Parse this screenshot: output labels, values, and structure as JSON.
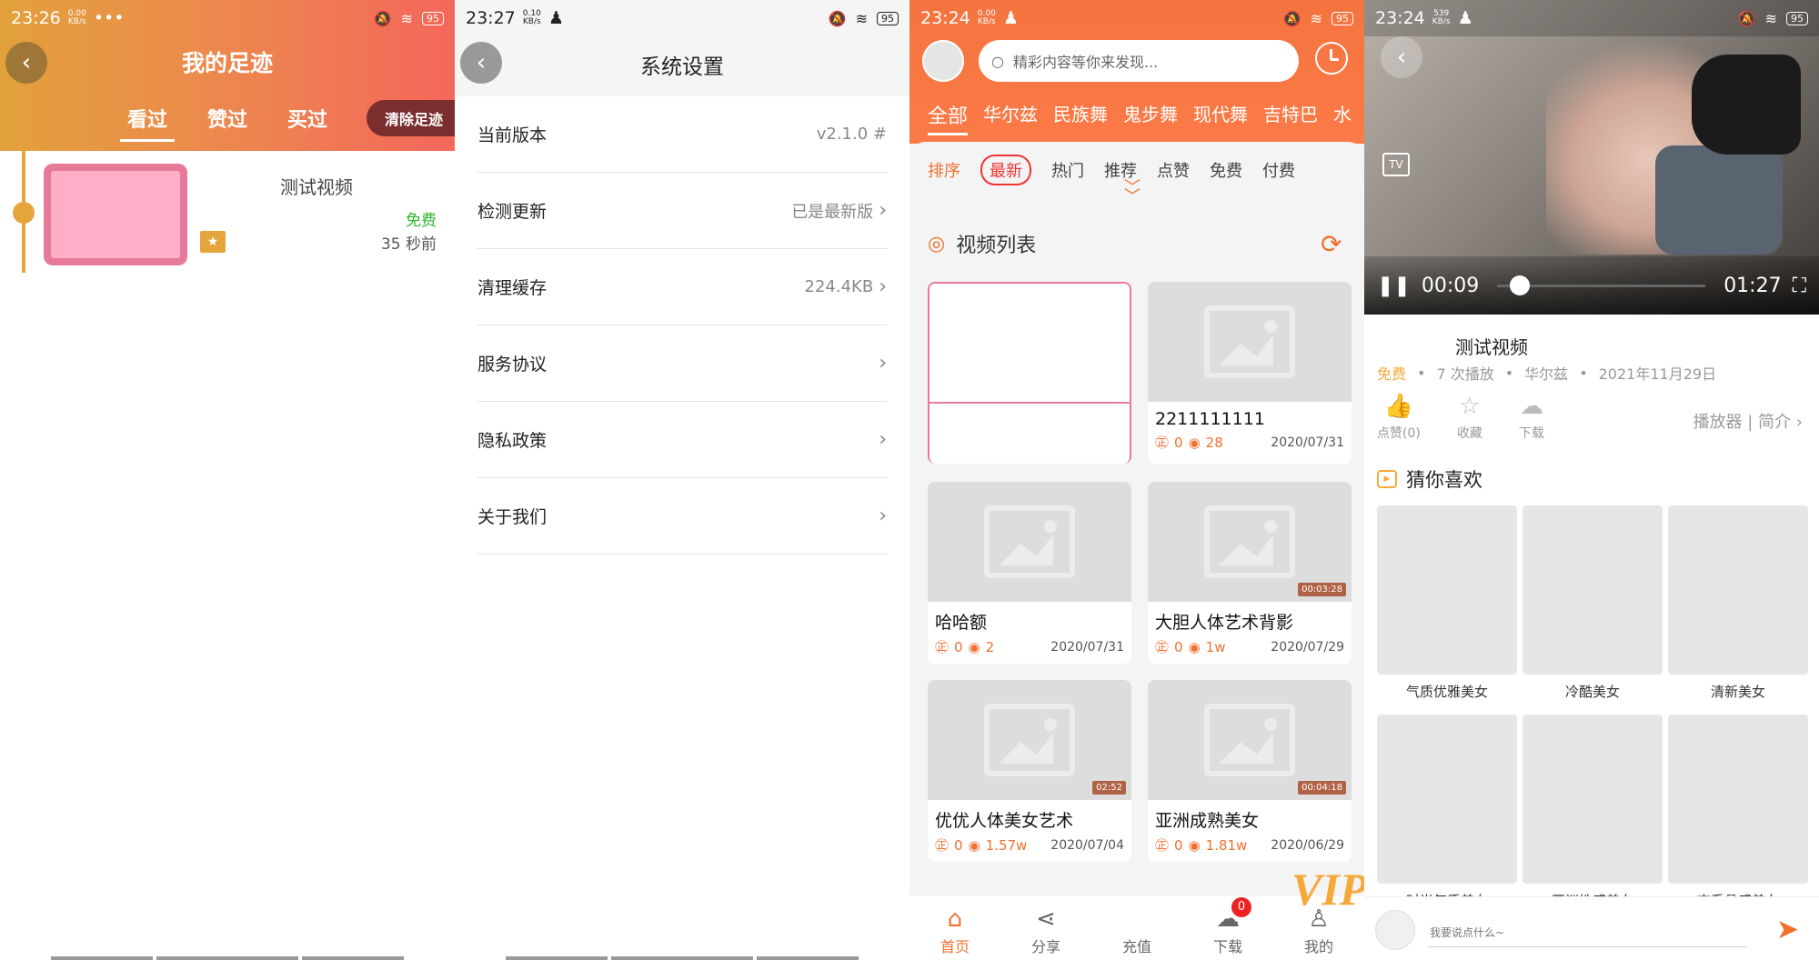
{
  "panel1": {
    "status": {
      "time": "23:26",
      "speed_top": "0.00",
      "speed_bottom": "KB/s",
      "extra": "•••",
      "battery": "95"
    },
    "title": "我的足迹",
    "tabs": [
      "看过",
      "赞过",
      "买过"
    ],
    "clear_label": "清除足迹",
    "item": {
      "title": "测试视频",
      "price": "免费",
      "ago": "35 秒前",
      "star": "★"
    }
  },
  "panel2": {
    "status": {
      "time": "23:27",
      "speed_top": "0.10",
      "speed_bottom": "KB/s",
      "battery": "95"
    },
    "title": "系统设置",
    "rows": [
      {
        "label": "当前版本",
        "value": "v2.1.0 #",
        "chev": ""
      },
      {
        "label": "检测更新",
        "value": "已是最新版",
        "chev": "›"
      },
      {
        "label": "清理缓存",
        "value": "224.4KB",
        "chev": "›"
      },
      {
        "label": "服务协议",
        "value": "",
        "chev": "›"
      },
      {
        "label": "隐私政策",
        "value": "",
        "chev": "›"
      },
      {
        "label": "关于我们",
        "value": "",
        "chev": "›"
      }
    ]
  },
  "panel3": {
    "status": {
      "time": "23:24",
      "speed_top": "0.00",
      "speed_bottom": "KB/s",
      "battery": "95"
    },
    "search_placeholder": "精彩内容等你来发现...",
    "categories": [
      "全部",
      "华尔兹",
      "民族舞",
      "鬼步舞",
      "现代舞",
      "吉特巴",
      "水"
    ],
    "sorts": [
      "排序",
      "最新",
      "热门",
      "推荐",
      "点赞",
      "免费",
      "付费"
    ],
    "list_title": "视频列表",
    "cards": [
      {
        "title": "",
        "likes": "",
        "views": "",
        "date": "",
        "dur": ""
      },
      {
        "title": "2211111111",
        "likes": "0",
        "views": "28",
        "date": "2020/07/31",
        "dur": ""
      },
      {
        "title": "哈哈额",
        "likes": "0",
        "views": "2",
        "date": "2020/07/31",
        "dur": ""
      },
      {
        "title": "大胆人体艺术背影",
        "likes": "0",
        "views": "1w",
        "date": "2020/07/29",
        "dur": "00:03:28"
      },
      {
        "title": "优优人体美女艺术",
        "likes": "0",
        "views": "1.57w",
        "date": "2020/07/04",
        "dur": "02:52"
      },
      {
        "title": "亚洲成熟美女",
        "likes": "0",
        "views": "1.81w",
        "date": "2020/06/29",
        "dur": "00:04:18"
      }
    ],
    "nav": [
      {
        "label": "首页",
        "icon": "⌂"
      },
      {
        "label": "分享",
        "icon": "⋖"
      },
      {
        "label": "充值",
        "icon": ""
      },
      {
        "label": "下载",
        "icon": "☁"
      },
      {
        "label": "我的",
        "icon": "♙"
      }
    ],
    "vip_text": "VIP",
    "download_badge": "0"
  },
  "panel4": {
    "status": {
      "time": "23:24",
      "speed_top": "539",
      "speed_bottom": "KB/s",
      "battery": "95"
    },
    "player": {
      "current": "00:09",
      "total": "01:27",
      "progress": 0.06,
      "tv": "TV"
    },
    "title": "测试视频",
    "meta": {
      "price": "免费",
      "plays": "7 次播放",
      "category": "华尔兹",
      "date": "2021年11月29日"
    },
    "actions": [
      {
        "label": "点赞(0)",
        "icon": "👍"
      },
      {
        "label": "收藏",
        "icon": "☆"
      },
      {
        "label": "下载",
        "icon": "☁"
      }
    ],
    "player_link": "播放器 | 简介",
    "guess_title": "猜你喜欢",
    "guess_items": [
      "气质优雅美女",
      "冷酷美女",
      "清新美女",
      "时尚气质美女",
      "亚洲性感美女",
      "杏系骨感美女"
    ],
    "comment_placeholder": "我要说点什么~"
  }
}
